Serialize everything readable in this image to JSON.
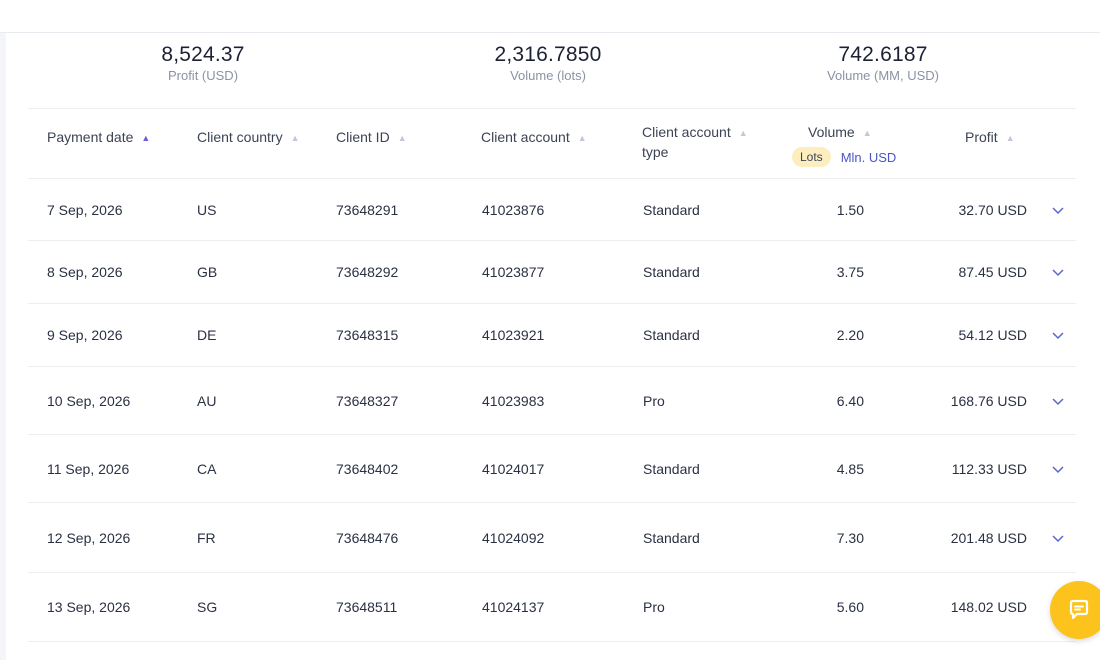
{
  "summary": {
    "profit": {
      "value": "8,524.37",
      "label": "Profit (USD)"
    },
    "volume_lots": {
      "value": "2,316.7850",
      "label": "Volume (lots)"
    },
    "volume_mm": {
      "value": "742.6187",
      "label": "Volume (MM, USD)"
    }
  },
  "table": {
    "columns": {
      "payment_date": "Payment date",
      "client_country": "Client country",
      "client_id": "Client ID",
      "client_account": "Client account",
      "client_account_type_1": "Client account",
      "client_account_type_2": "type",
      "volume": "Volume",
      "profit": "Profit"
    },
    "volume_units": {
      "active": "Lots",
      "alternate": "Mln. USD"
    },
    "rows": [
      {
        "date": "7 Sep, 2026",
        "country": "US",
        "client_id": "73648291",
        "account": "41023876",
        "type": "Standard",
        "volume": "1.50",
        "profit": "32.70 USD"
      },
      {
        "date": "8 Sep, 2026",
        "country": "GB",
        "client_id": "73648292",
        "account": "41023877",
        "type": "Standard",
        "volume": "3.75",
        "profit": "87.45 USD"
      },
      {
        "date": "9 Sep, 2026",
        "country": "DE",
        "client_id": "73648315",
        "account": "41023921",
        "type": "Standard",
        "volume": "2.20",
        "profit": "54.12 USD"
      },
      {
        "date": "10 Sep, 2026",
        "country": "AU",
        "client_id": "73648327",
        "account": "41023983",
        "type": "Pro",
        "volume": "6.40",
        "profit": "168.76 USD"
      },
      {
        "date": "11 Sep, 2026",
        "country": "CA",
        "client_id": "73648402",
        "account": "41024017",
        "type": "Standard",
        "volume": "4.85",
        "profit": "112.33 USD"
      },
      {
        "date": "12 Sep, 2026",
        "country": "FR",
        "client_id": "73648476",
        "account": "41024092",
        "type": "Standard",
        "volume": "7.30",
        "profit": "201.48 USD"
      },
      {
        "date": "13 Sep, 2026",
        "country": "SG",
        "client_id": "73648511",
        "account": "41024137",
        "type": "Pro",
        "volume": "5.60",
        "profit": "148.02 USD"
      }
    ]
  },
  "icons": {
    "sort_asc": "sort-ascending-icon",
    "expand": "chevron-down-icon",
    "chat": "chat-icon"
  },
  "colors": {
    "accent": "#6a61d9",
    "chip_bg": "#fdeec0",
    "chat_button": "#fcc31c"
  }
}
